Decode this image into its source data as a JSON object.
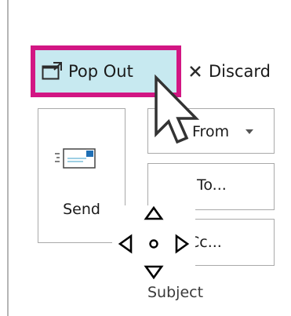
{
  "toolbar": {
    "popout_label": "Pop Out",
    "discard_label": "Discard"
  },
  "compose": {
    "send_label": "Send",
    "from_label": "From",
    "to_label": "To...",
    "cc_label": "Cc...",
    "subject_label": "Subject"
  },
  "colors": {
    "highlight_border": "#d21683",
    "highlight_fill": "#c7e9f0",
    "button_border": "#a9a9a9"
  },
  "icons": {
    "popout": "popout-window-icon",
    "discard": "close-icon",
    "send": "envelope-send-icon",
    "from_caret": "chevron-down-icon",
    "move": "move-arrows-icon",
    "pointer": "mouse-pointer-icon"
  }
}
